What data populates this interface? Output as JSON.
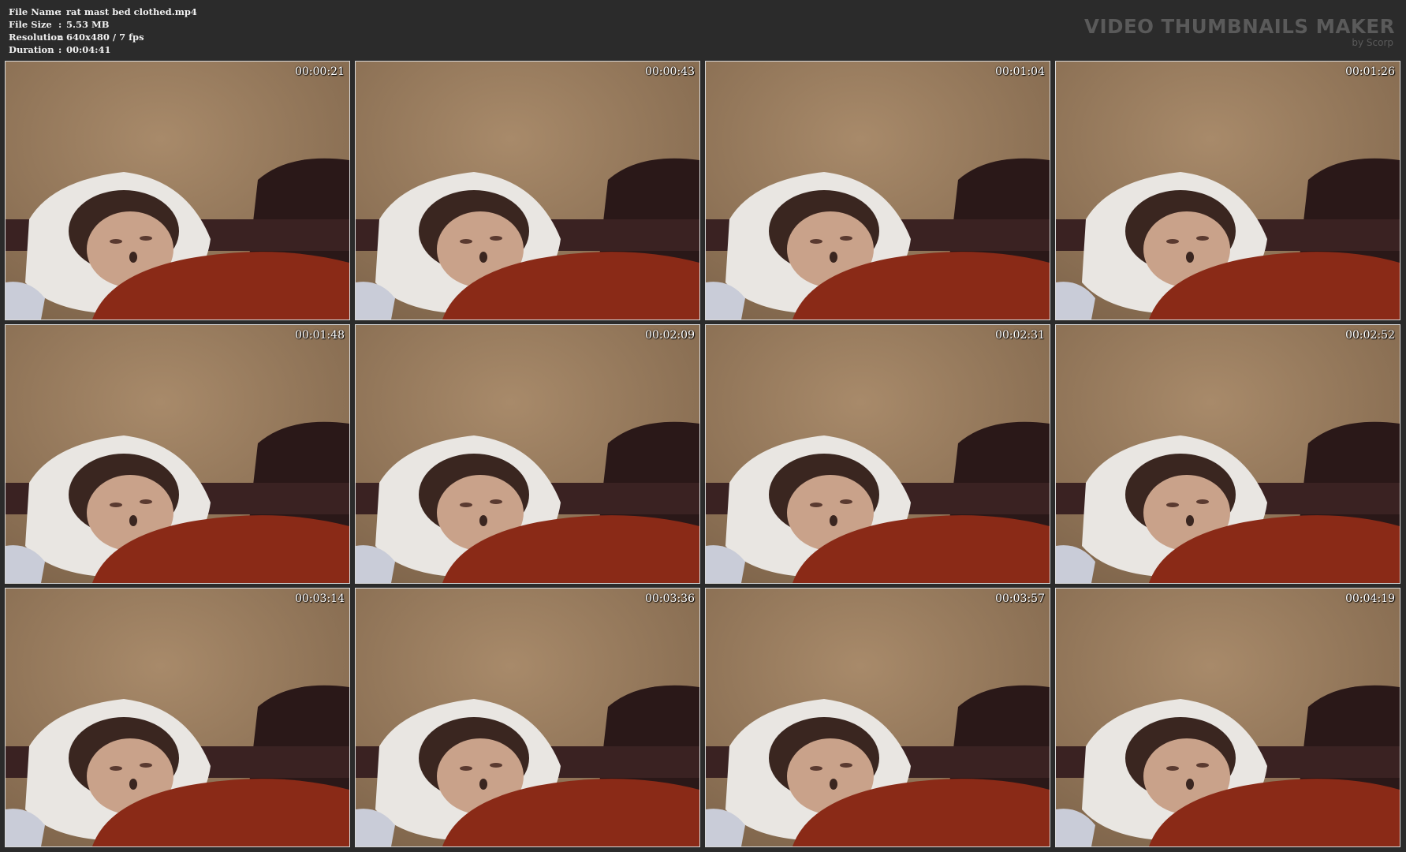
{
  "info": {
    "rows": [
      {
        "key": "File Name",
        "sep": ":",
        "value": "rat mast bed clothed.mp4"
      },
      {
        "key": "File Size",
        "sep": ":",
        "value": "5.53 MB"
      },
      {
        "key": "Resolution",
        "sep": ":",
        "value": "640x480 / 7 fps"
      },
      {
        "key": "Duration",
        "sep": ":",
        "value": "00:04:41"
      }
    ]
  },
  "brand": {
    "title": "VIDEO THUMBNAILS MAKER",
    "subtitle": "by Scorp"
  },
  "thumbnails": [
    {
      "timestamp": "00:00:21"
    },
    {
      "timestamp": "00:00:43"
    },
    {
      "timestamp": "00:01:04"
    },
    {
      "timestamp": "00:01:26"
    },
    {
      "timestamp": "00:01:48"
    },
    {
      "timestamp": "00:02:09"
    },
    {
      "timestamp": "00:02:31"
    },
    {
      "timestamp": "00:02:52"
    },
    {
      "timestamp": "00:03:14"
    },
    {
      "timestamp": "00:03:36"
    },
    {
      "timestamp": "00:03:57"
    },
    {
      "timestamp": "00:04:19"
    }
  ],
  "colors": {
    "background": "#2b2b2b",
    "wall": "#9a7c5e",
    "pillow": "#e9e6e2",
    "blanket": "#8a2a17",
    "hair": "#3a2620",
    "skin": "#c9a28a"
  }
}
